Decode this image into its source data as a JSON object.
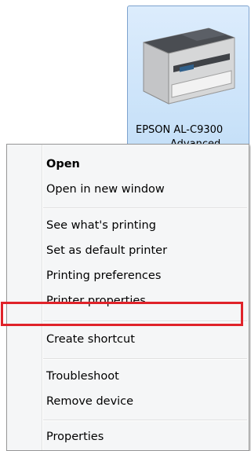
{
  "device": {
    "label_line1": "EPSON AL-C9300",
    "label_line2": "Advanced",
    "icon": "printer-icon"
  },
  "context_menu": {
    "items": [
      {
        "label": "Open",
        "bold": true
      },
      {
        "label": "Open in new window"
      },
      {
        "label": "See what's printing"
      },
      {
        "label": "Set as default printer"
      },
      {
        "label": "Printing preferences"
      },
      {
        "label": "Printer properties",
        "highlighted": true
      },
      {
        "label": "Create shortcut"
      },
      {
        "label": "Troubleshoot"
      },
      {
        "label": "Remove device"
      },
      {
        "label": "Properties"
      }
    ]
  },
  "colors": {
    "highlight_border": "#e0232a",
    "selection_fill": "#cfe5fa",
    "menu_background": "#f5f6f7"
  }
}
